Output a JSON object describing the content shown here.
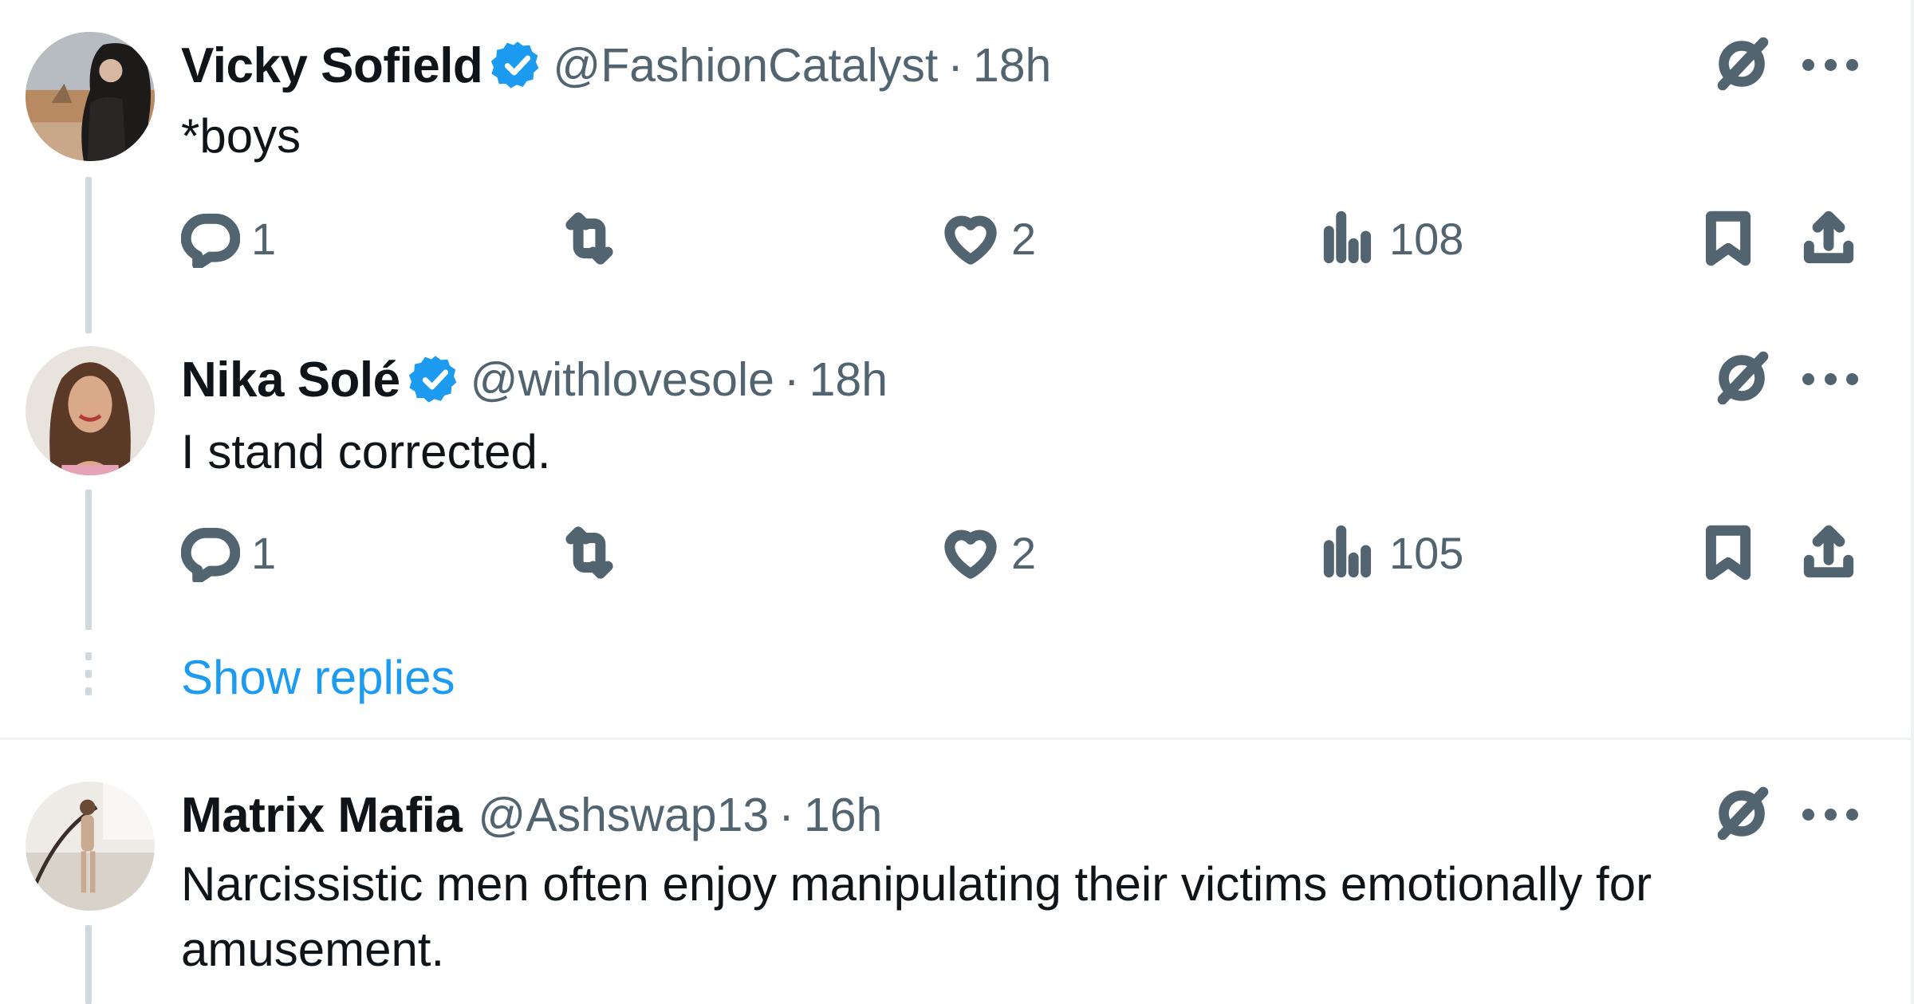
{
  "tweets": [
    {
      "name": "Vicky Sofield",
      "verified": true,
      "handle": "@FashionCatalyst",
      "separator": "·",
      "time": "18h",
      "text": "*boys",
      "replies": "1",
      "retweets": "",
      "likes": "2",
      "views": "108"
    },
    {
      "name": "Nika Solé",
      "verified": true,
      "handle": "@withlovesole",
      "separator": "·",
      "time": "18h",
      "text": "I stand corrected.",
      "replies": "1",
      "retweets": "",
      "likes": "2",
      "views": "105"
    },
    {
      "name": "Matrix Mafia",
      "verified": false,
      "handle": "@Ashswap13",
      "separator": "·",
      "time": "16h",
      "text_line1": "Narcissistic men often enjoy manipulating their victims emotionally for",
      "text_line2": "amusement."
    }
  ],
  "show_replies": "Show replies",
  "icons": [
    "reply-icon",
    "retweet-icon",
    "like-icon",
    "views-icon",
    "bookmark-icon",
    "share-icon",
    "grok-icon",
    "more-icon",
    "verified-badge-icon"
  ],
  "colors": {
    "text": "#0f1419",
    "secondary": "#536471",
    "link": "#1d9bf0",
    "verified": "#1d9bf0",
    "line": "#cfd9de"
  }
}
